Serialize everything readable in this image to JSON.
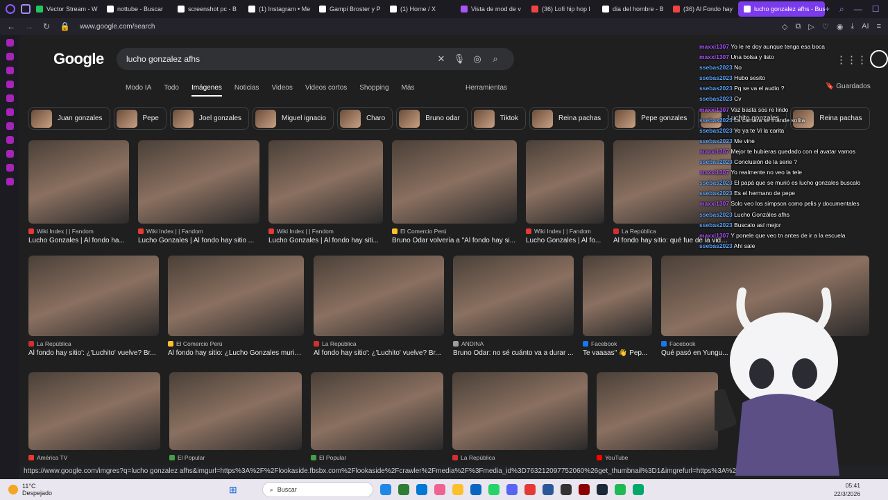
{
  "browser": {
    "tabs": [
      {
        "label": "Vector Stream - W",
        "color": "#22c55e"
      },
      {
        "label": "nottube - Buscar",
        "color": "#ffffff"
      },
      {
        "label": "screenshot pc - B",
        "color": "#ffffff"
      },
      {
        "label": "(1) Instagram • Me",
        "color": "#ffffff"
      },
      {
        "label": "Gampi Broster y P",
        "color": "#ffffff"
      },
      {
        "label": "(1) Home / X",
        "color": "#ffffff"
      },
      {
        "label": "Vista de mod de v",
        "color": "#a855f7"
      },
      {
        "label": "(36) Lofi hip hop l",
        "color": "#ef4444"
      },
      {
        "label": "dia del hombre - B",
        "color": "#ffffff"
      },
      {
        "label": "(36) Al Fondo hay",
        "color": "#ef4444"
      },
      {
        "label": "lucho gonzalez afhs - Bus",
        "color": "#ffffff",
        "active": true
      }
    ],
    "url": "www.google.com/search",
    "status_url": "https://www.google.com/imgres?q=lucho gonzalez afhs&imgurl=https%3A%2F%2Flookaside.fbsbx.com%2Flookaside%2Fcrawler%2Fmedia%2F%3Fmedia_id%3D763212097752060%26get_thumbnail%3D1&imgrefurl=https%3A%2F%2Fwww.faceb"
  },
  "google": {
    "logo": "Google",
    "query": "lucho gonzalez afhs",
    "nav": [
      "Modo IA",
      "Todo",
      "Imágenes",
      "Noticias",
      "Videos",
      "Videos cortos",
      "Shopping",
      "Más"
    ],
    "active_nav": "Imágenes",
    "tools": "Herramientas",
    "saved": "Guardados",
    "chips": [
      "Juan gonzales",
      "Pepe",
      "Joel gonzales",
      "Miguel ignacio",
      "Charo",
      "Bruno odar",
      "Tiktok",
      "Reina pachas",
      "Pepe gonzales",
      "Luchito gonzales",
      "Reina pachas"
    ]
  },
  "results": [
    [
      {
        "source": "Wiki Index | | Fandom",
        "title": "Lucho Gonzales | Al fondo ha...",
        "color": "#e53935"
      },
      {
        "source": "Wiki Index | | Fandom",
        "title": "Lucho Gonzales | Al fondo hay sitio ...",
        "color": "#e53935"
      },
      {
        "source": "Wiki Index | | Fandom",
        "title": "Lucho Gonzales | Al fondo hay siti...",
        "color": "#e53935"
      },
      {
        "source": "El Comercio Perú",
        "title": "Bruno Odar volvería a \"Al fondo hay si...",
        "color": "#fbc02d"
      },
      {
        "source": "Wiki Index | | Fandom",
        "title": "Lucho Gonzales | Al fo...",
        "color": "#e53935"
      },
      {
        "source": "La República",
        "title": "Al fondo hay sitio: qué fue de la vida ...",
        "color": "#d32f2f"
      }
    ],
    [
      {
        "source": "La República",
        "title": "Al fondo hay sitio': ¿'Luchito' vuelve? Br...",
        "color": "#d32f2f"
      },
      {
        "source": "El Comercio Perú",
        "title": "Al fondo hay sitio: ¿Lucho Gonzales murió...",
        "color": "#fbc02d"
      },
      {
        "source": "La República",
        "title": "Al fondo hay sitio': ¿'Luchito' vuelve? Br...",
        "color": "#d32f2f"
      },
      {
        "source": "ANDINA",
        "title": "Bruno Odar: no sé cuánto va a durar ...",
        "color": "#9e9e9e"
      },
      {
        "source": "Facebook",
        "title": "Te vaaaas\" 👋 Pep...",
        "color": "#1877f2"
      },
      {
        "source": "Facebook",
        "title": "Qué pasó en Yungu...",
        "color": "#1877f2"
      }
    ],
    [
      {
        "source": "América TV",
        "title": "",
        "color": "#e53935"
      },
      {
        "source": "El Popular",
        "title": "",
        "color": "#43a047"
      },
      {
        "source": "El Popular",
        "title": "",
        "color": "#43a047"
      },
      {
        "source": "La República",
        "title": "",
        "color": "#d32f2f"
      },
      {
        "source": "YouTube",
        "title": "",
        "color": "#ff0000"
      }
    ]
  ],
  "chat": [
    {
      "user": "maxxi1307",
      "msg": "Yo le re doy aunque tenga esa boca",
      "c": "u1"
    },
    {
      "user": "maxxi1307",
      "msg": "Una bolsa y listo",
      "c": "u1"
    },
    {
      "user": "ssebas2023",
      "msg": "No",
      "c": "u2"
    },
    {
      "user": "ssebas2023",
      "msg": "Hubo sesito",
      "c": "u2"
    },
    {
      "user": "ssebas2023",
      "msg": "Pq se va el audio ?",
      "c": "u2"
    },
    {
      "user": "ssebas2023",
      "msg": "Cv",
      "c": "u2"
    },
    {
      "user": "maxxi1307",
      "msg": "Vaz basta sos re lindo",
      "c": "u1"
    },
    {
      "user": "ssebas2023",
      "msg": "La camara se mande solita",
      "c": "u2"
    },
    {
      "user": "ssebas2023",
      "msg": "Yo ya te Vi la carita",
      "c": "u2"
    },
    {
      "user": "ssebas2023",
      "msg": "Me vine",
      "c": "u2"
    },
    {
      "user": "maxxi1307",
      "msg": "Mejor te hubieras quedado con el avatar vamos",
      "c": "u1"
    },
    {
      "user": "ssebas2023",
      "msg": "Conclusión de la serie ?",
      "c": "u2"
    },
    {
      "user": "maxxi1307",
      "msg": "Yo realmente no veo la tele",
      "c": "u1"
    },
    {
      "user": "ssebas2023",
      "msg": "El papá que se murió es lucho gonzales buscalo",
      "c": "u2"
    },
    {
      "user": "ssebas2023",
      "msg": "Es el hermano de pepe",
      "c": "u2"
    },
    {
      "user": "maxxi1307",
      "msg": "Solo veo los simpson como pelis y documentales",
      "c": "u1"
    },
    {
      "user": "ssebas2023",
      "msg": "Lucho Gonzáles afhs",
      "c": "u2"
    },
    {
      "user": "ssebas2023",
      "msg": "Buscalo así mejor",
      "c": "u2"
    },
    {
      "user": "maxxi1307",
      "msg": "Y ponele que veo tn antes de ir a la escuela",
      "c": "u1"
    },
    {
      "user": "ssebas2023",
      "msg": "Ahí sale",
      "c": "u2"
    }
  ],
  "taskbar": {
    "temp": "11°C",
    "weather": "Despejado",
    "search": "Buscar",
    "time": "05:41",
    "date": "22/3/2026",
    "apps": [
      "#1e88e5",
      "#2e7d32",
      "#0078d4",
      "#f06292",
      "#fbc02d",
      "#0a66c2",
      "#25d366",
      "#5865f2",
      "#e53935",
      "#2b579a",
      "#333333",
      "#8b0000",
      "#1b2838",
      "#1db954",
      "#00a86b"
    ]
  }
}
